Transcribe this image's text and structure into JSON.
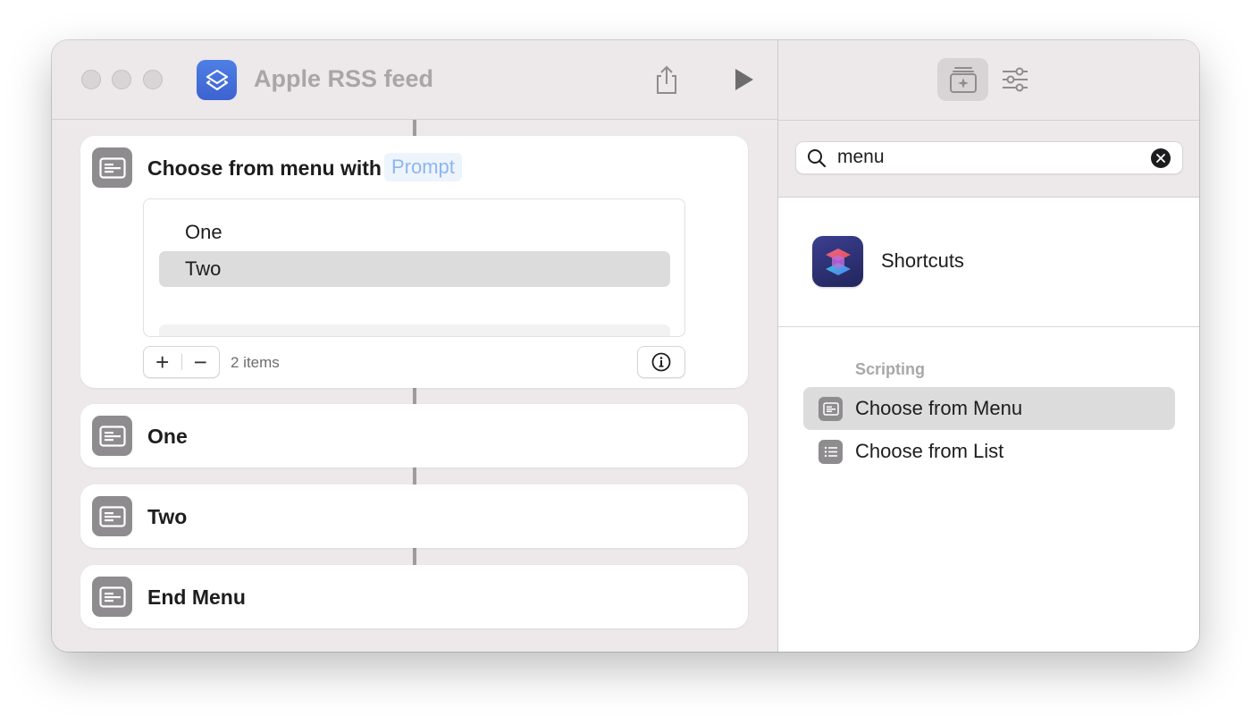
{
  "window": {
    "title": "Apple RSS feed"
  },
  "toolbar": {
    "share_icon": "share-icon",
    "run_icon": "play-icon",
    "library_icon": "action-library-icon",
    "settings_icon": "sliders-icon"
  },
  "actions": [
    {
      "title": "Choose from menu with",
      "token": "Prompt",
      "menu_items": [
        "One",
        "Two"
      ],
      "selected_item": "Two",
      "item_count": "2 items",
      "add_label": "+",
      "remove_label": "−"
    },
    {
      "title": "One"
    },
    {
      "title": "Two"
    },
    {
      "title": "End Menu"
    }
  ],
  "search": {
    "value": "menu"
  },
  "apps": [
    {
      "label": "Shortcuts"
    }
  ],
  "results": {
    "section": "Scripting",
    "items": [
      {
        "label": "Choose from Menu",
        "icon": "menu-icon",
        "selected": true
      },
      {
        "label": "Choose from List",
        "icon": "list-icon",
        "selected": false
      }
    ]
  },
  "colors": {
    "accent_blue": "#8cb6f0",
    "action_gray": "#8e8c8e",
    "selection": "#dcdcdc"
  }
}
